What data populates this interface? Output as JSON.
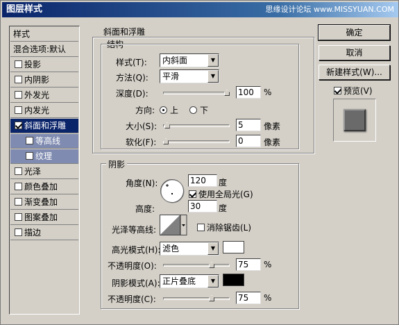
{
  "window": {
    "title": "图层样式",
    "watermark": "思缘设计论坛 www.MISSYUAN.COM"
  },
  "sidebar": {
    "header": "样式",
    "blend_options": "混合选项:默认",
    "items": [
      {
        "label": "投影",
        "checked": false
      },
      {
        "label": "内阴影",
        "checked": false
      },
      {
        "label": "外发光",
        "checked": false
      },
      {
        "label": "内发光",
        "checked": false
      },
      {
        "label": "斜面和浮雕",
        "checked": true
      },
      {
        "label": "等高线",
        "checked": false
      },
      {
        "label": "纹理",
        "checked": false
      },
      {
        "label": "光泽",
        "checked": false
      },
      {
        "label": "颜色叠加",
        "checked": false
      },
      {
        "label": "渐变叠加",
        "checked": false
      },
      {
        "label": "图案叠加",
        "checked": false
      },
      {
        "label": "描边",
        "checked": false
      }
    ]
  },
  "bevel": {
    "section_title": "斜面和浮雕",
    "structure_title": "结构",
    "style_label": "样式(T):",
    "style_value": "内斜面",
    "technique_label": "方法(Q):",
    "technique_value": "平滑",
    "depth_label": "深度(D):",
    "depth_value": "100",
    "depth_unit": "%",
    "depth_fraction": 1.0,
    "direction_label": "方向:",
    "direction_up": "上",
    "direction_down": "下",
    "size_label": "大小(S):",
    "size_value": "5",
    "size_unit": "像素",
    "size_fraction": 0.02,
    "soften_label": "软化(F):",
    "soften_value": "0",
    "soften_unit": "像素",
    "soften_fraction": 0.0
  },
  "shading": {
    "title": "阴影",
    "angle_label": "角度(N):",
    "angle_value": "120",
    "angle_unit": "度",
    "global_light_label": "使用全局光(G)",
    "altitude_label": "高度:",
    "altitude_value": "30",
    "altitude_unit": "度",
    "gloss_label": "光泽等高线:",
    "antialias_label": "消除锯齿(L)",
    "highlight_label": "高光模式(H):",
    "highlight_value": "滤色",
    "highlight_color": "#ffffff",
    "hl_opacity_label": "不透明度(O):",
    "hl_opacity_value": "75",
    "hl_opacity_unit": "%",
    "hl_opacity_fraction": 0.75,
    "shadow_label": "阴影模式(A):",
    "shadow_value": "正片叠底",
    "shadow_color": "#000000",
    "sh_opacity_label": "不透明度(C):",
    "sh_opacity_value": "75",
    "sh_opacity_unit": "%",
    "sh_opacity_fraction": 0.75
  },
  "buttons": {
    "ok": "确定",
    "cancel": "取消",
    "new_style": "新建样式(W)...",
    "preview": "预览(V)"
  }
}
